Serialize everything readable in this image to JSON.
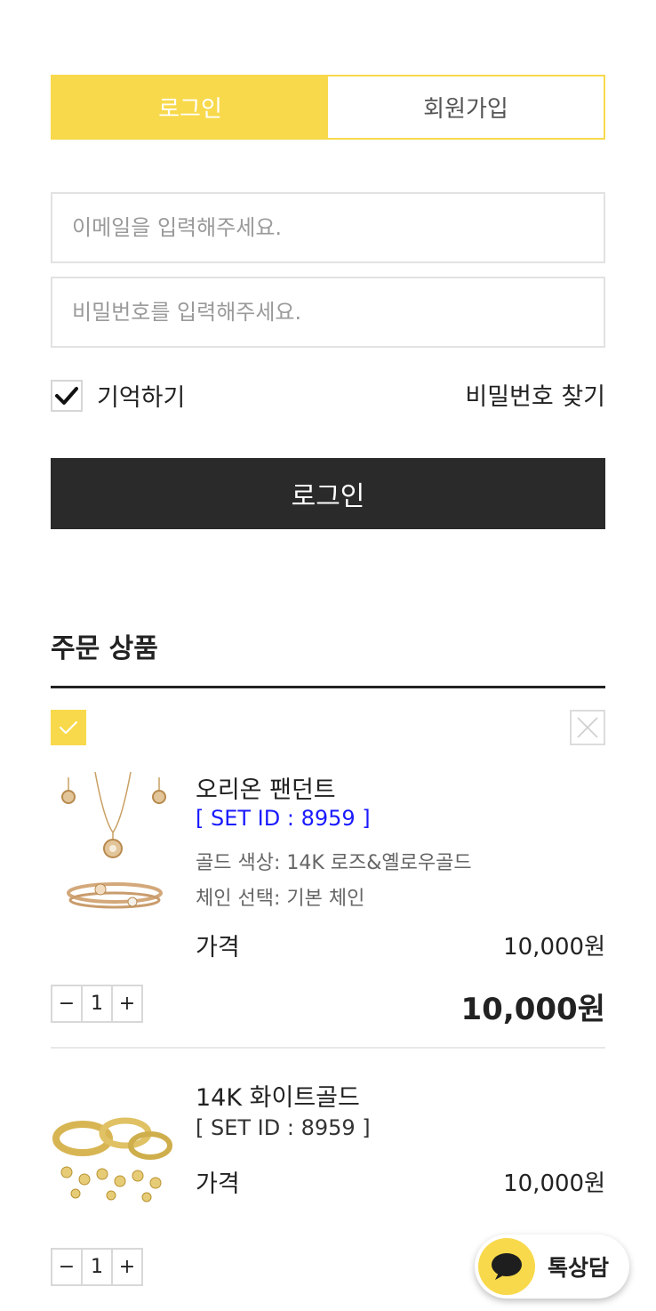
{
  "tabs": {
    "login": "로그인",
    "signup": "회원가입"
  },
  "form": {
    "email_placeholder": "이메일을 입력해주세요.",
    "password_placeholder": "비밀번호를 입력해주세요.",
    "remember_label": "기억하기",
    "find_password": "비밀번호 찾기",
    "login_button": "로그인"
  },
  "order": {
    "title": "주문 상품",
    "items": [
      {
        "name": "오리온 팬던트",
        "set_id": "[ SET ID : 8959 ]",
        "set_id_color": "#1a1aff",
        "options": [
          {
            "key": "골드 색상:",
            "value": "14K 로즈&옐로우골드"
          },
          {
            "key": "체인 선택:",
            "value": "기본 체인"
          }
        ],
        "price_label": "가격",
        "price": "10,000원",
        "qty": "1",
        "total": "10,000원"
      },
      {
        "name": "14K 화이트골드",
        "set_id": "[ SET ID : 8959 ]",
        "set_id_color": "#333333",
        "price_label": "가격",
        "price": "10,000원",
        "qty": "1"
      }
    ],
    "qty_minus": "−",
    "qty_plus": "+"
  },
  "chat": {
    "label": "톡상담"
  },
  "colors": {
    "accent": "#f8d94b",
    "dark": "#2a2a2a"
  }
}
